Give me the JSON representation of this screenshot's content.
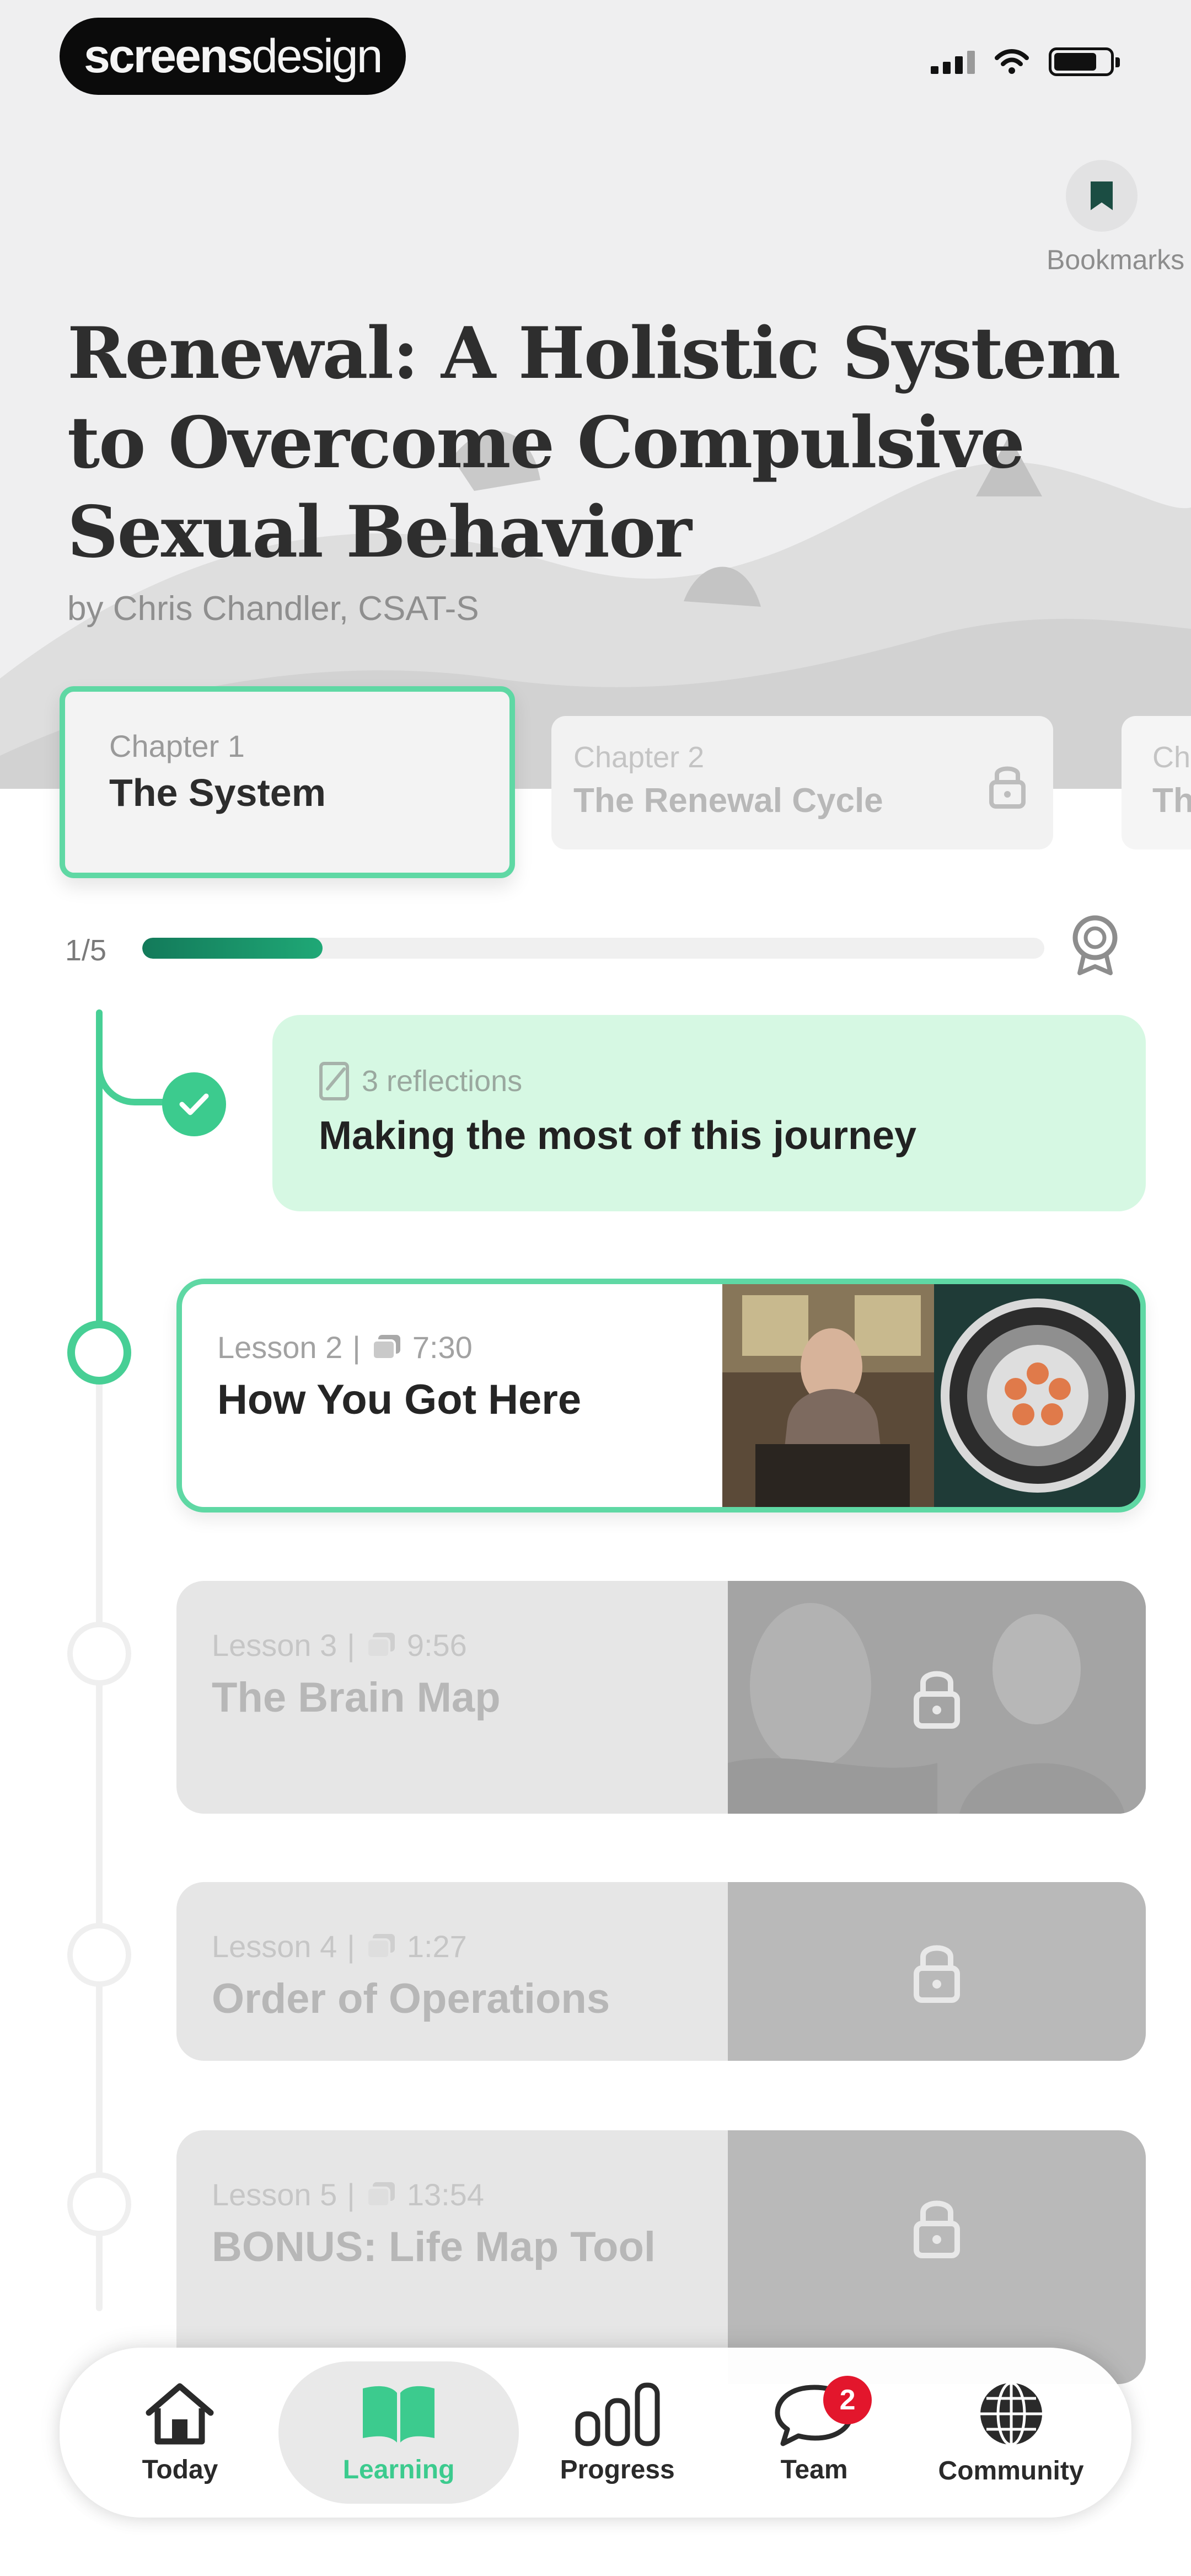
{
  "watermark": {
    "bold": "screens",
    "light": "design"
  },
  "bookmarks": {
    "label": "Bookmarks"
  },
  "course": {
    "title": "Renewal: A Holistic System to Overcome Compulsive Sexual Behavior",
    "author": "by Chris Chandler, CSAT-S"
  },
  "chapters": [
    {
      "label": "Chapter 1",
      "name": "The System",
      "locked": false,
      "selected": true
    },
    {
      "label": "Chapter 2",
      "name": "The Renewal Cycle",
      "locked": true,
      "selected": false
    },
    {
      "label": "Ch",
      "name": "Th",
      "locked": true,
      "selected": false
    }
  ],
  "progress": {
    "label": "1/5",
    "fraction": 0.2
  },
  "reflection": {
    "meta": "3 reflections",
    "title": "Making the most of this journey",
    "completed": true
  },
  "lessons": [
    {
      "number": "Lesson 2",
      "duration": "7:30",
      "title": "How You Got Here",
      "locked": false,
      "current": true
    },
    {
      "number": "Lesson 3",
      "duration": "9:56",
      "title": "The Brain Map",
      "locked": true
    },
    {
      "number": "Lesson 4",
      "duration": "1:27",
      "title": "Order of Operations",
      "locked": true
    },
    {
      "number": "Lesson 5",
      "duration": "13:54",
      "title": "BONUS: Life Map Tool",
      "locked": true
    }
  ],
  "nav": {
    "items": [
      {
        "label": "Today",
        "icon": "home-icon",
        "active": false
      },
      {
        "label": "Learning",
        "icon": "book-icon",
        "active": true
      },
      {
        "label": "Progress",
        "icon": "bar-chart-icon",
        "active": false
      },
      {
        "label": "Team",
        "icon": "chat-bubble-icon",
        "active": false,
        "badge": "2"
      },
      {
        "label": "Community",
        "icon": "globe-icon",
        "active": false
      }
    ]
  },
  "colors": {
    "accent": "#47cf95",
    "accent_dark": "#137a5a",
    "reflection_bg": "#d6f8e3",
    "badge": "#e3162c"
  }
}
